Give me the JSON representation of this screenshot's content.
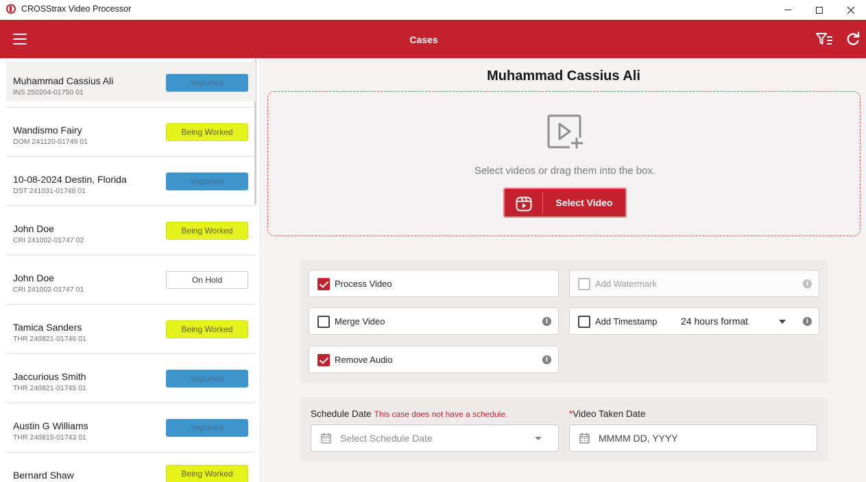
{
  "window": {
    "title": "CROSStrax Video Processor",
    "minimize_icon": "minimize-icon",
    "maximize_icon": "maximize-icon",
    "close_icon": "close-icon"
  },
  "appbar": {
    "title": "Cases",
    "menu_icon": "hamburger-menu-icon",
    "filter_icon": "filter-list-icon",
    "refresh_icon": "refresh-icon",
    "color": "#c4212f"
  },
  "cases": [
    {
      "name": "Muhammad Cassius Ali",
      "id": "INS 250204-01750 01",
      "status": "Imported",
      "status_type": "imported",
      "selected": true
    },
    {
      "name": "Wandismo Fairy",
      "id": "DOM 241120-01749 01",
      "status": "Being Worked",
      "status_type": "worked"
    },
    {
      "name": "10-08-2024 Destin, Florida",
      "id": "DST 241031-01748 01",
      "status": "Imported",
      "status_type": "imported"
    },
    {
      "name": "John Doe",
      "id": "CRI 241002-01747 02",
      "status": "Being Worked",
      "status_type": "worked"
    },
    {
      "name": "John Doe",
      "id": "CRI 241002-01747 01",
      "status": "On Hold",
      "status_type": "hold"
    },
    {
      "name": "Tamica Sanders",
      "id": "THR 240821-01746 01",
      "status": "Being Worked",
      "status_type": "worked"
    },
    {
      "name": "Jaccurious Smith",
      "id": "THR 240821-01745 01",
      "status": "Imported",
      "status_type": "imported"
    },
    {
      "name": "Austin G Williams",
      "id": "THR 240815-01743 01",
      "status": "Imported",
      "status_type": "imported"
    },
    {
      "name": "Bernard Shaw",
      "id": "",
      "status": "Being Worked",
      "status_type": "worked"
    }
  ],
  "main": {
    "case_title": "Muhammad Cassius Ali",
    "dropzone": {
      "icon": "video-add-icon",
      "text": "Select videos or drag them into the box.",
      "button_label": "Select Video",
      "button_icon": "video-library-icon"
    },
    "options": {
      "process_video": {
        "label": "Process Video",
        "checked": true
      },
      "add_watermark": {
        "label": "Add Watermark",
        "checked": false,
        "disabled": true
      },
      "merge_video": {
        "label": "Merge Video",
        "checked": false
      },
      "add_timestamp": {
        "label": "Add Timestamp",
        "checked": false,
        "format": "24 hours format"
      },
      "remove_audio": {
        "label": "Remove Audio",
        "checked": true
      },
      "info_icon": "info-icon"
    },
    "schedule": {
      "label": "Schedule Date",
      "note": "This case does not have a schedule.",
      "placeholder": "Select Schedule Date"
    },
    "video_taken": {
      "required_mark": "*",
      "label": "Video Taken Date",
      "placeholder": "MMMM DD, YYYY"
    }
  }
}
